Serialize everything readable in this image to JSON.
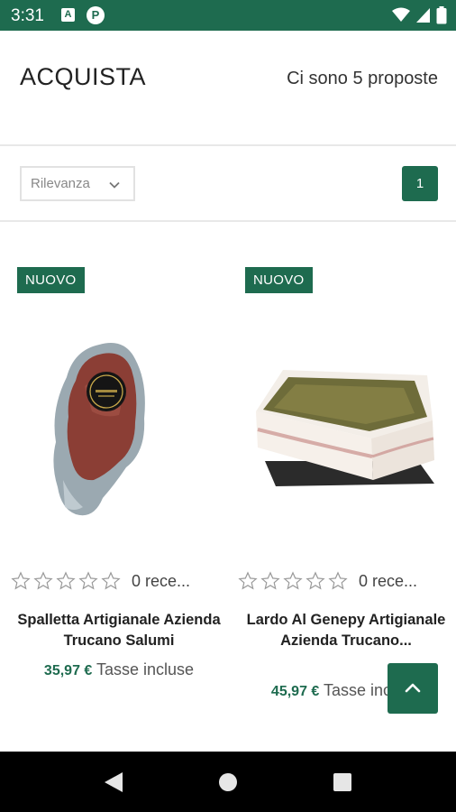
{
  "status_bar": {
    "time": "3:31",
    "icon_a": "A",
    "icon_p": "P",
    "icons": [
      "wifi-icon",
      "signal-icon",
      "battery-icon"
    ]
  },
  "header": {
    "title": "ACQUISTA",
    "proposal_count": "Ci sono 5 proposte"
  },
  "sort": {
    "selected": "Rilevanza",
    "icon": "chevron-down-icon"
  },
  "pagination": {
    "current_page": "1"
  },
  "products": [
    {
      "badge": "NUOVO",
      "image": "cured-ham-photo",
      "rating": 0,
      "max_rating": 5,
      "reviews": "0 rece...",
      "name": "Spalletta Artigianale Azienda Trucano Salumi",
      "price": "35,97 €",
      "tax": "Tasse incluse"
    },
    {
      "badge": "NUOVO",
      "image": "lardo-block-photo",
      "rating": 0,
      "max_rating": 5,
      "reviews": "0 rece...",
      "name": "Lardo Al Genepy Artigianale Azienda Trucano...",
      "price": "45,97 €",
      "tax": "Tasse incluse"
    }
  ],
  "scroll_top": {
    "icon": "chevron-up-icon"
  },
  "nav_bar": {
    "icons": [
      "back-icon",
      "home-icon",
      "recents-icon"
    ]
  },
  "colors": {
    "brand": "#1e6b4f",
    "status_bar": "#1e6b4f",
    "nav_bar": "#000000"
  }
}
